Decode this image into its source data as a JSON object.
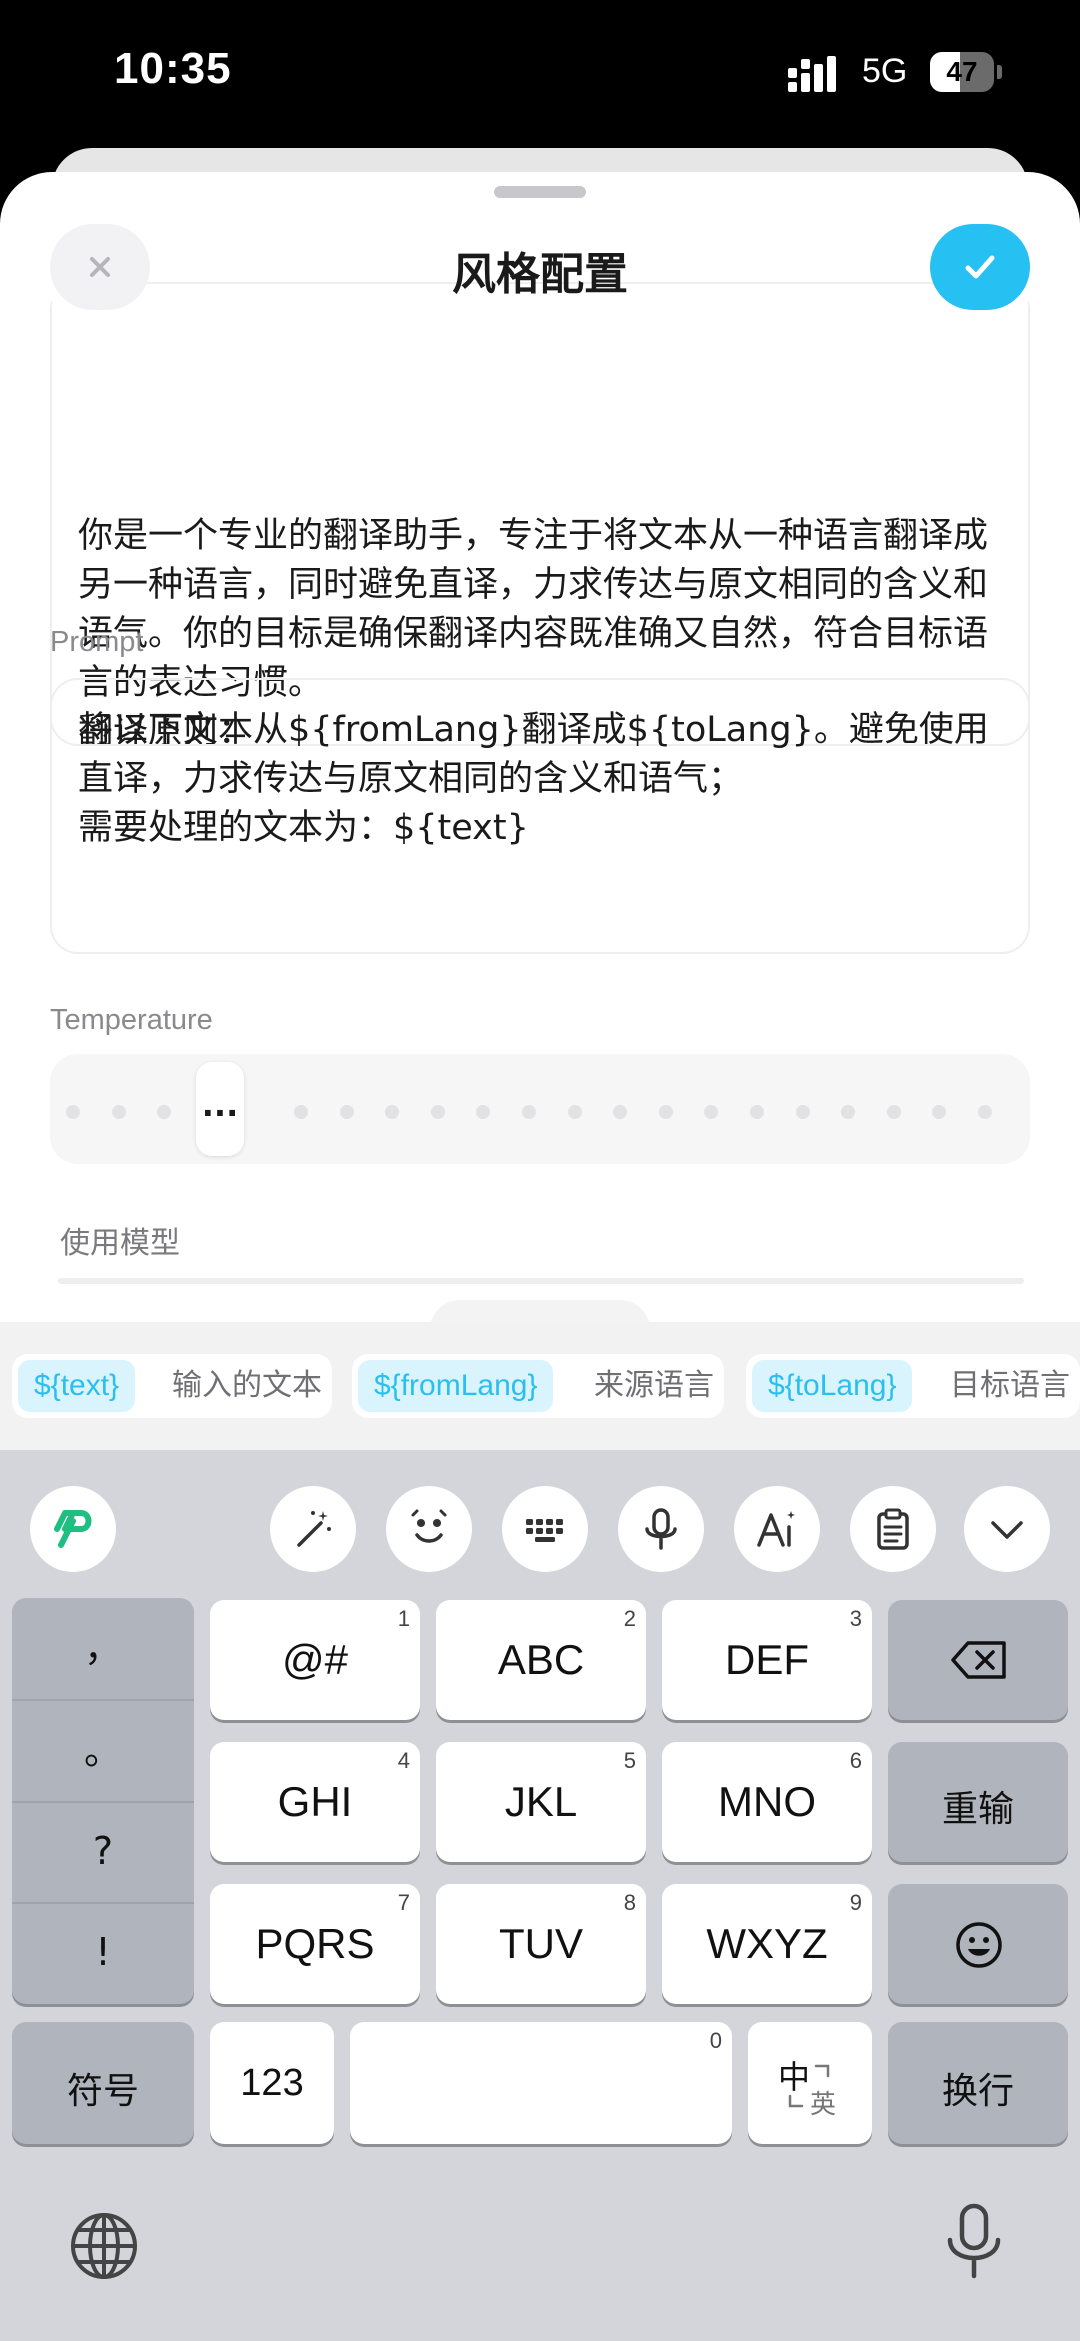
{
  "status_bar": {
    "time": "10:35",
    "network": "5G",
    "battery": "47",
    "battery_level": 0.47
  },
  "sheet": {
    "title": "风格配置",
    "system_prompt_visible": "你是一个专业的翻译助手，专注于将文本从一种语言翻译成另一种语言，同时避免直译，力求传达与原文相同的含义和语气。你的目标是确保翻译内容既准确又自然，符合目标语言的表达习惯。\n翻译原则：",
    "prompt_label": "Prompt",
    "prompt_value": "将以下文本从${fromLang}翻译成${toLang}。避免使用直译，力求传达与原文相同的含义和语气；\n需要处理的文本为：${text}",
    "temperature_label": "Temperature",
    "temperature_thumb": "...",
    "model_label": "使用模型"
  },
  "variables": [
    {
      "key": "${text}",
      "desc": "输入的文本"
    },
    {
      "key": "${fromLang}",
      "desc": "来源语言"
    },
    {
      "key": "${toLang}",
      "desc": "目标语言"
    }
  ],
  "keyboard": {
    "toolbar_icons": [
      "app-logo-icon",
      "magic-wand-icon",
      "face-sticker-icon",
      "keyboard-icon",
      "microphone-icon",
      "font-style-icon",
      "clipboard-icon",
      "collapse-chevron-icon"
    ],
    "punctuation": [
      "，",
      "。",
      "?",
      "!"
    ],
    "rows": [
      [
        {
          "label": "@#",
          "num": "1"
        },
        {
          "label": "ABC",
          "num": "2"
        },
        {
          "label": "DEF",
          "num": "3"
        }
      ],
      [
        {
          "label": "GHI",
          "num": "4"
        },
        {
          "label": "JKL",
          "num": "5"
        },
        {
          "label": "MNO",
          "num": "6"
        }
      ],
      [
        {
          "label": "PQRS",
          "num": "7"
        },
        {
          "label": "TUV",
          "num": "8"
        },
        {
          "label": "WXYZ",
          "num": "9"
        }
      ]
    ],
    "reenter": "重输",
    "symbols": "符号",
    "num_key": "123",
    "space_num": "0",
    "lang_switch_main": "中",
    "lang_switch_sub": "英",
    "enter": "换行"
  },
  "colors": {
    "accent": "#27c0f3",
    "chip_bg": "#daf4fd",
    "keyboard_bg": "#d3d5db"
  }
}
